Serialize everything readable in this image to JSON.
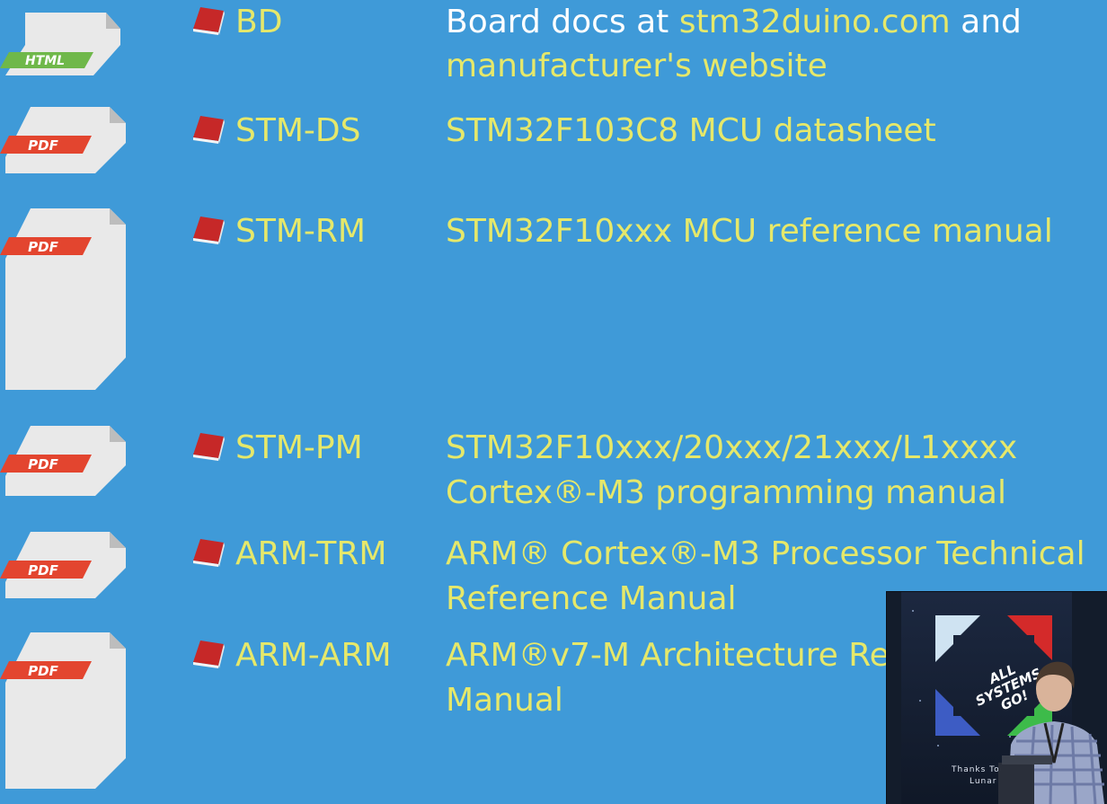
{
  "colors": {
    "background": "#3f9ad8",
    "text_accent": "#e6e86a",
    "text_plain": "#ffffff",
    "html_badge": "#6fb84a",
    "pdf_badge": "#e3452f"
  },
  "rows": [
    {
      "badge": "HTML",
      "abbr": "BD",
      "desc_prefix": "Board docs at ",
      "link": "stm32duino.com",
      "desc_suffix": " and",
      "desc_line2": "manufacturer's website"
    },
    {
      "badge": "PDF",
      "abbr": "STM-DS",
      "desc_line1": "STM32F103C8 MCU datasheet"
    },
    {
      "badge": "PDF",
      "abbr": "STM-RM",
      "desc_line1": "STM32F10xxx MCU reference manual"
    },
    {
      "badge": "PDF",
      "abbr": "STM-PM",
      "desc_line1": "STM32F10xxx/20xxx/21xxx/L1xxxx",
      "desc_line2": "Cortex®-M3 programming manual"
    },
    {
      "badge": "PDF",
      "abbr": "ARM-TRM",
      "desc_line1": "ARM® Cortex®-M3 Processor Technical",
      "desc_line2": "Reference Manual"
    },
    {
      "badge": "PDF",
      "abbr": "ARM-ARM",
      "desc_line1": "ARM®v7-M Architecture Re",
      "desc_line2": "Manual"
    }
  ],
  "icons": {
    "row_marker": "red-book-icon",
    "doc_html": "html-file-icon",
    "doc_pdf": "pdf-file-icon"
  },
  "video": {
    "logo_line1": "ALL",
    "logo_line2": "SYSTEMS",
    "logo_line3": "GO!",
    "thanks_line1": "Thanks To Our",
    "thanks_line2": "Lunar Spo"
  }
}
